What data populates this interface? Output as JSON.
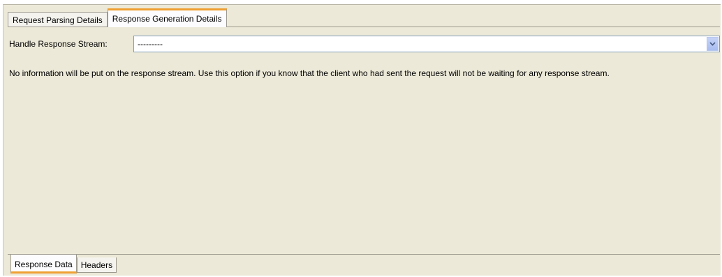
{
  "tabs": {
    "top": [
      {
        "label": "Request Parsing Details",
        "active": false
      },
      {
        "label": "Response Generation Details",
        "active": true
      }
    ],
    "bottom": [
      {
        "label": "Response Data",
        "active": true
      },
      {
        "label": "Headers",
        "active": false
      }
    ]
  },
  "response_stream": {
    "label": "Handle Response Stream:",
    "selected_value": "---------",
    "arrow_icon": "chevron-down-icon"
  },
  "info_text": "No information will be put on the response stream. Use this option if you know that the client who had sent the request will not be waiting for any response stream.",
  "colors": {
    "panel_bg": "#ece9d8",
    "active_tab_accent": "#f0a030",
    "dropdown_button": "#b9c9ef"
  }
}
